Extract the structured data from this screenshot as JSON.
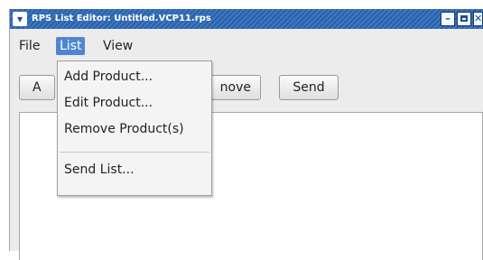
{
  "titlebar": {
    "title": "RPS List Editor: Untitled.VCP11.rps",
    "menu_icon": "chevron-down-icon",
    "minimize_icon": "minimize-icon",
    "maximize_icon": "maximize-icon",
    "close_icon": "close-icon"
  },
  "menubar": {
    "file": "File",
    "list": "List",
    "view": "View"
  },
  "toolbar": {
    "add_visible": "A",
    "remove_visible": "nove",
    "send": "Send"
  },
  "dropdown": {
    "items": [
      "Add Product...",
      "Edit Product...",
      "Remove Product(s)",
      "Send List..."
    ]
  },
  "colors": {
    "titlebar": "#2a61a8",
    "menu_highlight": "#4f86cf"
  }
}
